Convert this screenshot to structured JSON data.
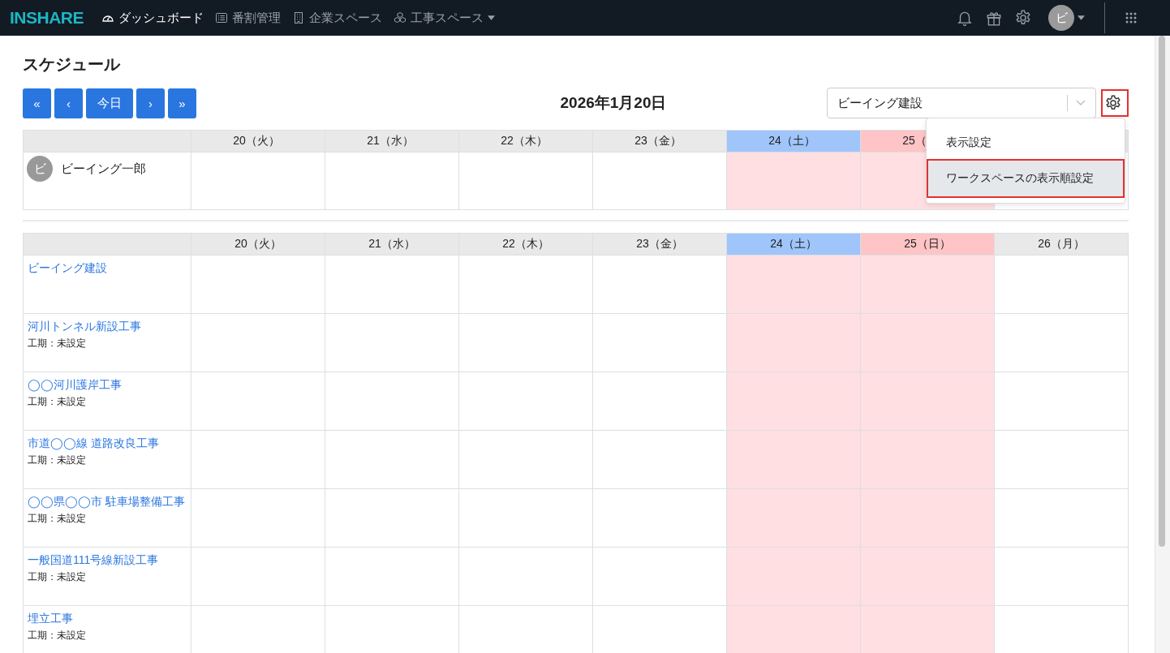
{
  "navbar": {
    "logo": "INSHARE",
    "links": [
      {
        "label": "ダッシュボード",
        "selected": true,
        "caret": false
      },
      {
        "label": "番割管理",
        "selected": false,
        "caret": false
      },
      {
        "label": "企業スペース",
        "selected": false,
        "caret": false
      },
      {
        "label": "工事スペース",
        "selected": false,
        "caret": true
      }
    ],
    "avatar": "ビ"
  },
  "page": {
    "title": "スケジュール",
    "nav_buttons": [
      "«",
      "‹",
      "今日",
      "›",
      "»"
    ],
    "date": "2026年1月20日",
    "workspace_select": {
      "value": "ビーイング建設"
    },
    "settings_highlighted": true,
    "menu": [
      {
        "label": "表示設定",
        "selected": false,
        "highlighted": false
      },
      {
        "label": "ワークスペースの表示順設定",
        "selected": true,
        "highlighted": true
      }
    ]
  },
  "members_table": {
    "days": [
      {
        "label": "20（火）",
        "kind": "weekday"
      },
      {
        "label": "21（水）",
        "kind": "weekday"
      },
      {
        "label": "22（木）",
        "kind": "weekday"
      },
      {
        "label": "23（金）",
        "kind": "weekday"
      },
      {
        "label": "24（土）",
        "kind": "saturday"
      },
      {
        "label": "25（",
        "kind": "sunday"
      },
      {
        "kind": "weekday"
      }
    ],
    "rows": [
      {
        "avatar": "ビ",
        "name": "ビーイング一郎"
      }
    ]
  },
  "workspace_table": {
    "days": [
      {
        "label": "20（火）",
        "kind": "weekday"
      },
      {
        "label": "21（水）",
        "kind": "weekday"
      },
      {
        "label": "22（木）",
        "kind": "weekday"
      },
      {
        "label": "23（金）",
        "kind": "weekday"
      },
      {
        "label": "24（土）",
        "kind": "saturday"
      },
      {
        "label": "25（日）",
        "kind": "sunday"
      },
      {
        "label": "26（月）",
        "kind": "weekday"
      }
    ],
    "rows": [
      {
        "name": "ビーイング建設"
      },
      {
        "name": "河川トンネル新設工事",
        "period": "工期：未設定"
      },
      {
        "name": "◯◯河川護岸工事",
        "period": "工期：未設定"
      },
      {
        "name": "市道◯◯線 道路改良工事",
        "period": "工期：未設定"
      },
      {
        "name": "◯◯県◯◯市 駐車場整備工事",
        "period": "工期：未設定"
      },
      {
        "name": "一般国道111号線新設工事",
        "period": "工期：未設定"
      },
      {
        "name": "埋立工事",
        "period": "工期：未設定"
      }
    ]
  }
}
